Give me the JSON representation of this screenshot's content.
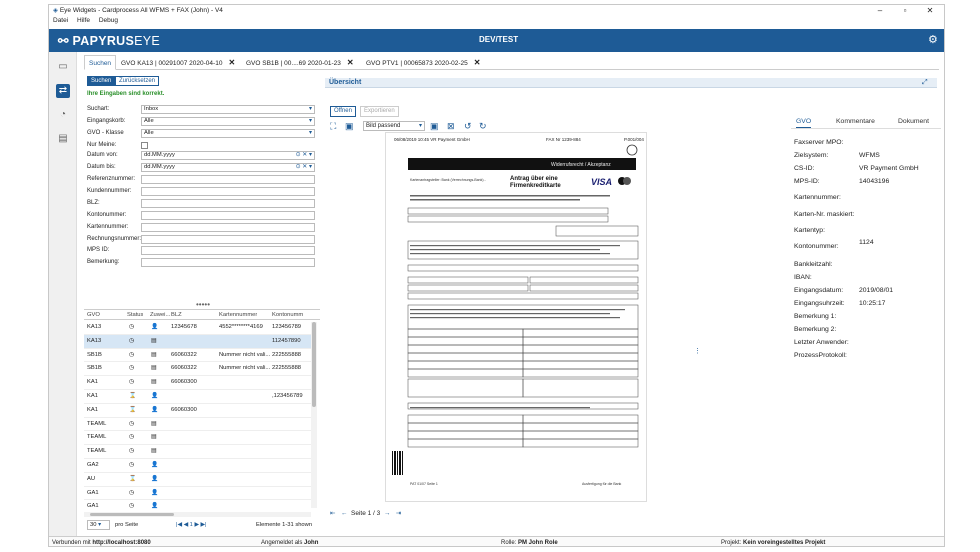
{
  "window": {
    "title": "Eye Widgets - Cardprocess All WFMS + FAX (John) - V4",
    "min": "–",
    "max": "▫",
    "close": "✕"
  },
  "menu": [
    "Datei",
    "Hilfe",
    "Debug"
  ],
  "app": {
    "logo_main": "PAPYRUS",
    "logo_eye": "EYE",
    "env": "DEV/TEST",
    "accent": "#1e5b96"
  },
  "tabs": [
    {
      "label": "Suchen",
      "active": true
    },
    {
      "label": "GVO KA13 | 00291007 2020-04-10",
      "close": "✕"
    },
    {
      "label": "GVO SB1B | 00....69 2020-01-23",
      "close": "✕"
    },
    {
      "label": "GVO PTV1 | 00065873 2020-02-25",
      "close": "✕"
    }
  ],
  "search": {
    "btn_search": "Suchen",
    "btn_reset": "Zurücksetzen",
    "ok_message": "Ihre Eingaben sind korrekt.",
    "fields": [
      {
        "label": "Suchart:",
        "value": "Inbox",
        "type": "select"
      },
      {
        "label": "Eingangskorb:",
        "value": "Alle",
        "type": "select"
      },
      {
        "label": "GVO - Klasse",
        "value": "Alle",
        "type": "select"
      },
      {
        "label": "Nur Meine:",
        "value": "",
        "type": "check"
      },
      {
        "label": "Datum von:",
        "value": "dd.MM.yyyy",
        "type": "date"
      },
      {
        "label": "Datum bis:",
        "value": "dd.MM.yyyy",
        "type": "date"
      },
      {
        "label": "Referenznummer:",
        "value": "",
        "type": "text"
      },
      {
        "label": "Kundennummer:",
        "value": "",
        "type": "text"
      },
      {
        "label": "BLZ:",
        "value": "",
        "type": "text"
      },
      {
        "label": "Kontonummer:",
        "value": "",
        "type": "text"
      },
      {
        "label": "Kartennummer:",
        "value": "",
        "type": "text"
      },
      {
        "label": "Rechnungsnummer:",
        "value": "",
        "type": "text"
      },
      {
        "label": "MPS ID:",
        "value": "",
        "type": "text"
      },
      {
        "label": "Bemerkung:",
        "value": "",
        "type": "text"
      }
    ]
  },
  "grid": {
    "columns": [
      "GVO",
      "Status",
      "Zuwei...",
      "BLZ",
      "Kartennummer",
      "Kontonumm"
    ],
    "rows": [
      [
        "KA13",
        "◷",
        "👤",
        "12345678",
        "4552********4169",
        "123456789"
      ],
      [
        "KA13",
        "◷",
        "▤",
        "",
        "",
        "112457890"
      ],
      [
        "SB1B",
        "◷",
        "▤",
        "66060322",
        "Nummer nicht vali...",
        "222555888"
      ],
      [
        "SB1B",
        "◷",
        "▤",
        "66060322",
        "Nummer nicht vali...",
        "222555888"
      ],
      [
        "KA1",
        "◷",
        "▤",
        "66060300",
        "",
        ""
      ],
      [
        "KA1",
        "⌛",
        "👤",
        "",
        "",
        ",123456789"
      ],
      [
        "KA1",
        "⌛",
        "👤",
        "66060300",
        "",
        ""
      ],
      [
        "TEAML",
        "◷",
        "▤",
        "",
        "",
        ""
      ],
      [
        "TEAML",
        "◷",
        "▤",
        "",
        "",
        ""
      ],
      [
        "TEAML",
        "◷",
        "▤",
        "",
        "",
        ""
      ],
      [
        "GA2",
        "◷",
        "👤",
        "",
        "",
        ""
      ],
      [
        "AU",
        "⌛",
        "👤",
        "",
        "",
        ""
      ],
      [
        "GA1",
        "◷",
        "👤",
        "",
        "",
        ""
      ],
      [
        "GA1",
        "◷",
        "👤",
        "",
        "",
        ""
      ]
    ],
    "page_size": "30",
    "per_page_label": "pro Seite",
    "nav": "|◀ ◀ 1 ▶ ▶|",
    "count": "Elemente 1-31 shown"
  },
  "overview": {
    "title": "Übersicht",
    "btn_open": "Öffnen",
    "btn_export": "Exportieren",
    "zoom": "Bild passend",
    "page_label": "Seite 1 / 3"
  },
  "document": {
    "header_left": "06/08/2019   10:45  VR Payment GmbH",
    "header_right": "FAX Nr 1239-884",
    "header_page": "P.001/004",
    "banner": "Widerrufsrecht / Akzeptanz",
    "title_line1": "Antrag über eine",
    "title_line2": "Firmenkreditkarte",
    "sub1": "Kartenantragsteller: Bank (Verrechnungs-Bank) -",
    "brand": "VISA",
    "footer_left": "PAT 01/07   Seite 1",
    "footer_right": "Ausfertigung für die Bank"
  },
  "info": {
    "tabs": [
      "GVO",
      "Kommentare",
      "Dokument"
    ],
    "fields": [
      {
        "label": "Faxserver MPO:",
        "value": ""
      },
      {
        "label": "Zielsystem:",
        "value": "WFMS"
      },
      {
        "label": "CS-ID:",
        "value": "VR Payment GmbH"
      },
      {
        "label": "MPS-ID:",
        "value": "14043196"
      },
      {
        "label": "Kartennummer:",
        "value": ""
      },
      {
        "label": "Karten-Nr. maskiert:",
        "value": ""
      },
      {
        "label": "Kartentyp:",
        "value": ""
      },
      {
        "label": "Kontonummer:",
        "value": "1124"
      },
      {
        "label": "Bankleitzahl:",
        "value": ""
      },
      {
        "label": "IBAN:",
        "value": ""
      },
      {
        "label": "Eingangsdatum:",
        "value": "2019/08/01"
      },
      {
        "label": "Eingangsuhrzeit:",
        "value": "10:25:17"
      },
      {
        "label": "Bemerkung 1:",
        "value": ""
      },
      {
        "label": "Bemerkung 2:",
        "value": ""
      },
      {
        "label": "Letzter Anwender:",
        "value": ""
      },
      {
        "label": "ProzessProtokoll:",
        "value": ""
      }
    ]
  },
  "status": {
    "connected_label": "Verbunden mit",
    "connected_value": "http://localhost:8080",
    "login_label": "Angemeldet als",
    "login_value": "John",
    "role_label": "Rolle:",
    "role_value": "PM John Role",
    "project_label": "Projekt:",
    "project_value": "Kein voreingestelltes Projekt"
  }
}
